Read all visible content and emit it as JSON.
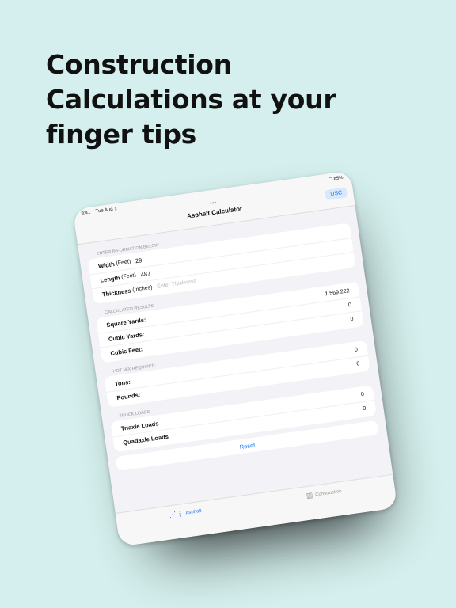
{
  "headline": {
    "line1": "Construction",
    "line2": "Calculations at your",
    "line3": "finger tips"
  },
  "statusbar": {
    "time": "9:41",
    "date": "Tue Aug 1",
    "battery": "85%"
  },
  "navbar": {
    "title": "Asphalt Calculator",
    "dots": "•••",
    "unit_button": "USC"
  },
  "input_section": {
    "label": "ENTER INFORMATION BELOW",
    "width": {
      "label": "Width",
      "unit": "(Feet)",
      "value": "29"
    },
    "length": {
      "label": "Length",
      "unit": "(Feet)",
      "value": "487"
    },
    "thickness": {
      "label": "Thickness",
      "unit": "(Inches)",
      "placeholder": "Enter Thickness"
    }
  },
  "results_section": {
    "label": "CALCULATED RESULTS",
    "square_yards": {
      "label": "Square Yards:",
      "value": "1,569.222"
    },
    "cubic_yards": {
      "label": "Cubic Yards:",
      "value": "0"
    },
    "cubic_feet": {
      "label": "Cubic Feet:",
      "value": "0"
    }
  },
  "hotmix_section": {
    "label": "HOT MIX REQUIRED",
    "tons": {
      "label": "Tons:",
      "value": "0"
    },
    "pounds": {
      "label": "Pounds:",
      "value": "0"
    }
  },
  "truck_section": {
    "label": "TRUCK LOADS",
    "triaxle": {
      "label": "Triaxle Loads",
      "value": "0"
    },
    "quadaxle": {
      "label": "Quadaxle Loads",
      "value": "0"
    }
  },
  "reset_label": "Reset",
  "tabs": {
    "asphalt": {
      "label": "Asphalt",
      "icon": "road-icon"
    },
    "construction": {
      "label": "Construction",
      "icon": "building-icon"
    }
  },
  "colors": {
    "background": "#d4efed",
    "accent": "#1f7af0"
  }
}
